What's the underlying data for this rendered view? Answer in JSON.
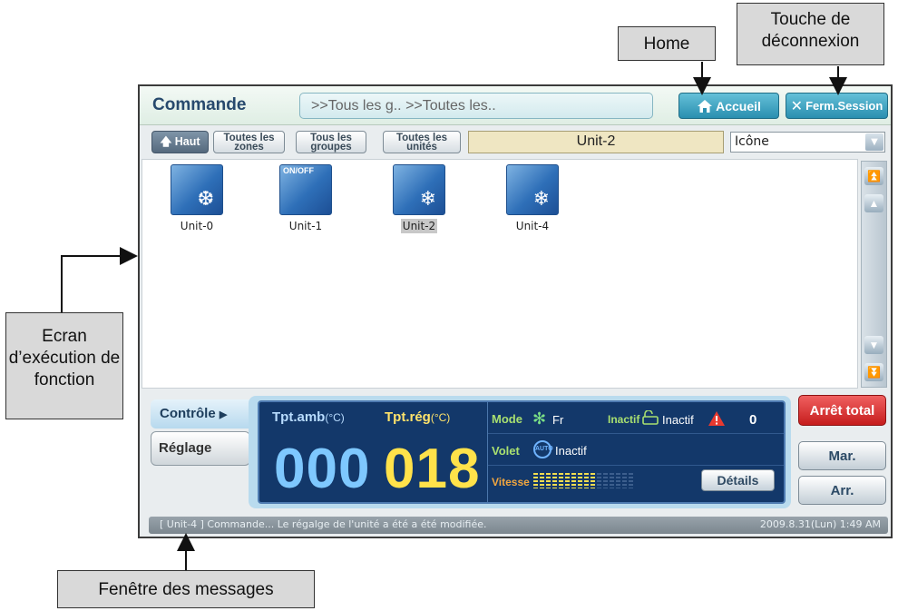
{
  "annotations": {
    "home": "Home",
    "logout": "Touche de déconnexion",
    "execution_screen": "Ecran d’exécution de fonction",
    "message_window": "Fenêtre des messages"
  },
  "header": {
    "title": "Commande",
    "breadcrumb": ">>Tous les g.. >>Toutes les..",
    "home_label": "Accueil",
    "logout_label": "Ferm.Session",
    "home_icon": "house-icon",
    "logout_icon": "x-icon"
  },
  "toolbar": {
    "up_label": "Haut",
    "all_zones": "Toutes les zones",
    "all_groups": "Tous les groupes",
    "all_units": "Toutes les unités",
    "selected_unit": "Unit-2",
    "view_mode": "Icône"
  },
  "units": [
    {
      "name": "Unit-0",
      "tag": "",
      "selected": false
    },
    {
      "name": "Unit-1",
      "tag": "ON/OFF",
      "selected": false
    },
    {
      "name": "Unit-2",
      "tag": "",
      "selected": true
    },
    {
      "name": "Unit-4",
      "tag": "",
      "selected": false
    }
  ],
  "tabs": {
    "control": "Contrôle",
    "settings": "Réglage"
  },
  "panel": {
    "room_temp_label": "Tpt.amb",
    "set_temp_label": "Tpt.rég",
    "temp_unit": "(°C)",
    "room_temp": "000",
    "set_temp": "018",
    "mode_label": "Mode",
    "mode_value": "Fr",
    "lock_label": "Inactif",
    "lock_value": "Inactif",
    "alarm_count": "0",
    "louver_label": "Volet",
    "louver_icon_text": "AUTO",
    "louver_value": "Inactif",
    "speed_label": "Vitesse",
    "details_label": "Détails"
  },
  "side_buttons": {
    "all_stop": "Arrêt total",
    "on": "Mar.",
    "off": "Arr."
  },
  "statusbar": {
    "message": "[ Unit-4 ] Commande... Le régalge de l'unité a été a été modifiée.",
    "datetime": "2009.8.31(Lun)  1:49 AM"
  },
  "colors": {
    "accent": "#2a8fb0",
    "panel_bg": "#13386a",
    "all_stop": "#c61d1d"
  }
}
